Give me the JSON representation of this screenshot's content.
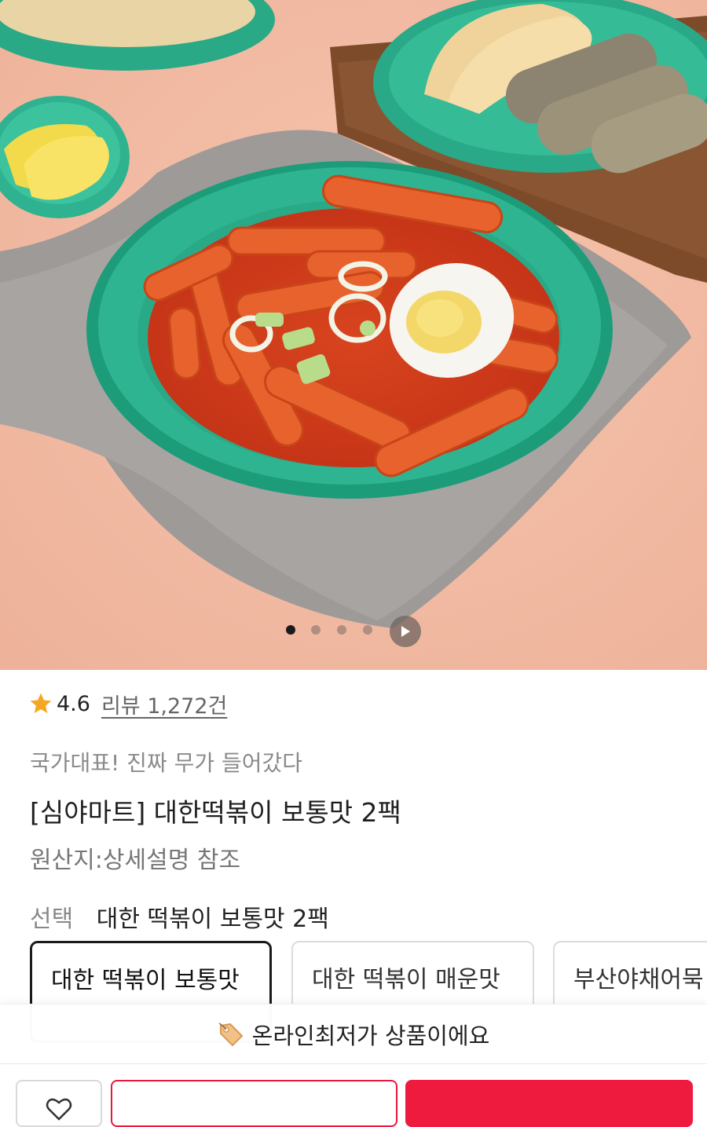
{
  "product": {
    "image_dots": 4,
    "active_dot": 0,
    "rating": "4.6",
    "review_link": "리뷰 1,272건",
    "tagline": "국가대표! 진짜 무가 들어갔다",
    "title": "[심야마트] 대한떡볶이 보통맛 2팩",
    "origin": "원산지:상세설명 참조"
  },
  "options": {
    "label": "선택",
    "selected_value": "대한 떡볶이 보통맛 2팩",
    "cards": [
      {
        "name": "대한 떡볶이 보통맛",
        "selected": true
      },
      {
        "name": "대한 떡볶이 매운맛",
        "selected": false
      },
      {
        "name": "부산야채어묵",
        "selected": false
      }
    ]
  },
  "banner": {
    "text": "온라인최저가 상품이에요",
    "icon": "price-tag-icon"
  },
  "bottom_bar": {
    "wish_icon": "heart-icon"
  },
  "colors": {
    "accent": "#ee1b3f",
    "star": "#f5a623",
    "plate": "#2fb491",
    "background": "#f2b9a0"
  }
}
